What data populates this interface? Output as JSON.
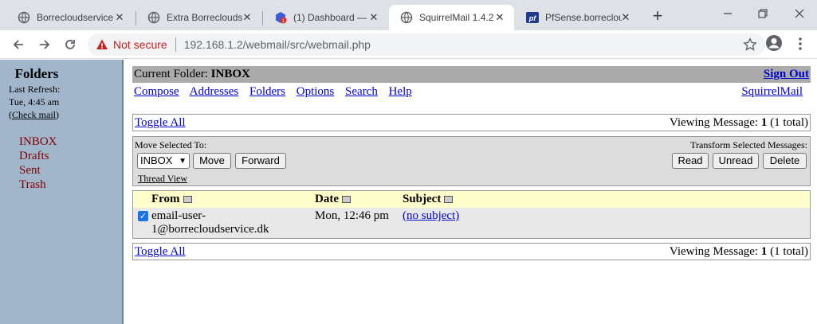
{
  "browser": {
    "tabs": [
      {
        "title": "Borrecloudservice",
        "icon": "globe-icon"
      },
      {
        "title": "Extra Borreclouds",
        "icon": "globe-icon"
      },
      {
        "title": "(1) Dashboard —",
        "icon": "dashboard-icon"
      },
      {
        "title": "SquirrelMail 1.4.2",
        "icon": "globe-icon",
        "active": true
      },
      {
        "title": "PfSense.borreclou",
        "icon": "pfsense-icon"
      }
    ],
    "security_label": "Not secure",
    "url": "192.168.1.2/webmail/src/webmail.php"
  },
  "sidebar": {
    "title": "Folders",
    "last_refresh_label": "Last Refresh:",
    "last_refresh_time": "Tue, 4:45 am",
    "check_mail_open": "(",
    "check_mail": "Check mail",
    "check_mail_close": ")",
    "folders": [
      "INBOX",
      "Drafts",
      "Sent",
      "Trash"
    ]
  },
  "main": {
    "current_folder_label": "Current Folder:",
    "current_folder": "INBOX",
    "sign_out": "Sign Out",
    "menu": [
      "Compose",
      "Addresses",
      "Folders",
      "Options",
      "Search",
      "Help"
    ],
    "brand_link": "SquirrelMail",
    "toggle_all": "Toggle All",
    "viewing_label": "Viewing Message:",
    "viewing_num": "1",
    "viewing_total": "(1 total)",
    "move_selected_label": "Move Selected To:",
    "move_target": "INBOX",
    "move_button": "Move",
    "forward_button": "Forward",
    "thread_view": "Thread View",
    "transform_label": "Transform Selected Messages:",
    "read_button": "Read",
    "unread_button": "Unread",
    "delete_button": "Delete",
    "columns": {
      "from": "From",
      "date": "Date",
      "subject": "Subject"
    },
    "messages": [
      {
        "from_line1": "email-user-",
        "from_line2": "1@borrecloudservice.dk",
        "date": "Mon, 12:46 pm",
        "subject": "(no subject)",
        "checked": true
      }
    ]
  },
  "colors": {
    "sidebar_bg": "#a2b6cb",
    "folder_link": "#800000",
    "header_bar": "#ababab",
    "column_header_bg": "#ffffcc",
    "link": "#0000cc",
    "not_secure": "#c5221f"
  }
}
